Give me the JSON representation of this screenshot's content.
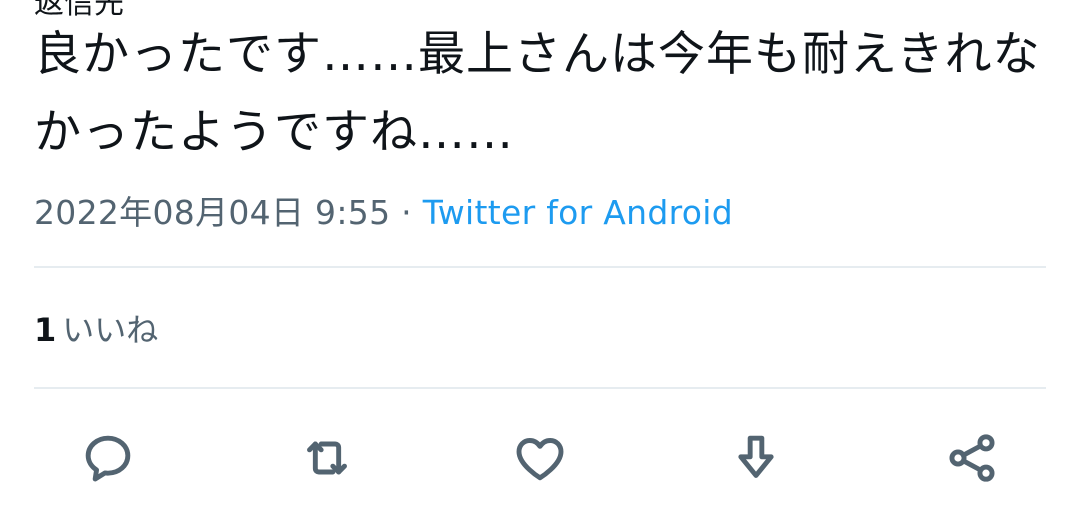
{
  "tweet": {
    "cut_off_prefix": "返信先",
    "cut_off_mention": "",
    "text": "良かったです……最上さんは今年も耐えきれなかったようですね……",
    "timestamp": "2022年08月04日 9:55",
    "separator": "·",
    "source": "Twitter for Android"
  },
  "engagement": {
    "likes_count": "1",
    "likes_label": "いいね"
  },
  "actions": [
    {
      "name": "reply",
      "icon": "reply-icon"
    },
    {
      "name": "retweet",
      "icon": "retweet-icon"
    },
    {
      "name": "like",
      "icon": "heart-icon"
    },
    {
      "name": "download",
      "icon": "download-icon"
    },
    {
      "name": "share",
      "icon": "share-icon"
    }
  ],
  "colors": {
    "text": "#0f1419",
    "secondary": "#536471",
    "accent": "#1d9bf0",
    "divider": "#e6ecf0"
  }
}
